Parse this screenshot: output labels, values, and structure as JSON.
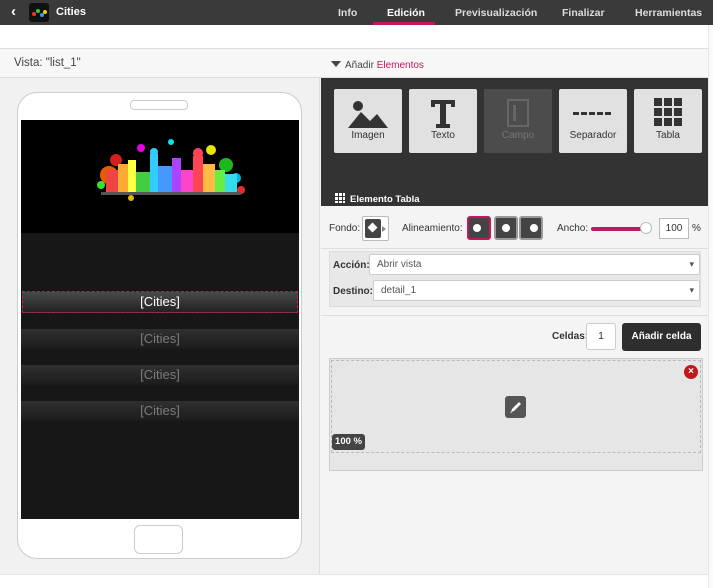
{
  "header": {
    "back_icon": "chevron-left-icon",
    "app_title": "Cities",
    "tabs": [
      {
        "label": "Info"
      },
      {
        "label": "Edición",
        "active": true
      },
      {
        "label": "Previsualización"
      },
      {
        "label": "Finalizar"
      },
      {
        "label": "Herramientas"
      }
    ]
  },
  "view": {
    "label": "Vista: \"list_1\""
  },
  "add_elements": {
    "prefix": "Añadir",
    "highlight": "Elementos"
  },
  "phone": {
    "rows": [
      {
        "label": "[Cities]",
        "selected": true
      },
      {
        "label": "[Cities]"
      },
      {
        "label": "[Cities]"
      },
      {
        "label": "[Cities]"
      }
    ]
  },
  "tools": [
    {
      "label": "Imagen",
      "icon": "image-icon"
    },
    {
      "label": "Texto",
      "icon": "text-t-icon"
    },
    {
      "label": "Campo",
      "icon": "field-icon",
      "disabled": true
    },
    {
      "label": "Separador",
      "icon": "separator-icon"
    },
    {
      "label": "Tabla",
      "icon": "table-icon"
    }
  ],
  "element": {
    "title": "Elemento Tabla"
  },
  "props": {
    "fondo_label": "Fondo:",
    "align_label": "Alineamiento:",
    "width_label": "Ancho:",
    "width_value": "100",
    "width_unit": "%",
    "width_fraction": 1.0
  },
  "action": {
    "accion_label": "Acción:",
    "accion_value": "Abrir vista",
    "destino_label": "Destino:",
    "destino_value": "detail_1"
  },
  "cells": {
    "label": "Celdas:",
    "count": "1",
    "add_button": "Añadir celda",
    "cell_width_badge": "100 %",
    "delete_symbol": "×"
  },
  "colors": {
    "accent": "#c4175f",
    "topbar": "#3a3a3a",
    "toolbox": "#333333",
    "delete": "#c0181d"
  }
}
